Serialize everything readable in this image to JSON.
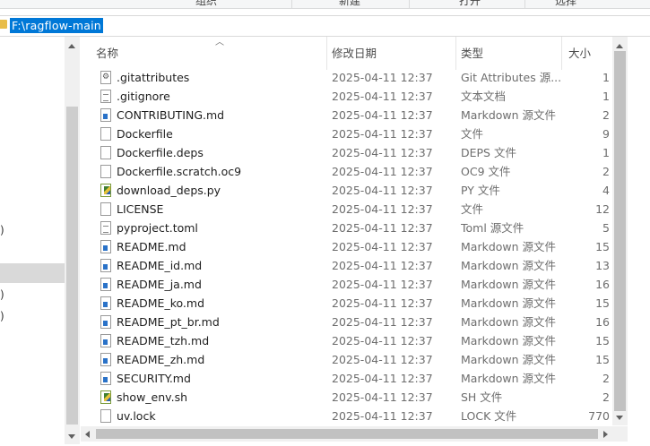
{
  "ribbon": {
    "groups": [
      {
        "label": "组织"
      },
      {
        "label": "新建"
      },
      {
        "label": "打开"
      },
      {
        "label": "选择"
      }
    ]
  },
  "address": {
    "path": "F:\\ragflow-main"
  },
  "nav": {
    "items": [
      {
        "label": ":)"
      },
      {
        "label": ")"
      },
      {
        "label": ":)"
      },
      {
        "label": ":)"
      }
    ],
    "selected_index": 1
  },
  "list": {
    "columns": {
      "name": "名称",
      "date": "修改日期",
      "type": "类型",
      "size": "大小"
    },
    "sort_column": "name",
    "files": [
      {
        "name": ".gitattributes",
        "date": "2025-04-11 12:37",
        "type": "Git Attributes 源...",
        "size": "1",
        "icon": "gear-file-icon"
      },
      {
        "name": ".gitignore",
        "date": "2025-04-11 12:37",
        "type": "文本文档",
        "size": "1",
        "icon": "text-file-icon"
      },
      {
        "name": "CONTRIBUTING.md",
        "date": "2025-04-11 12:37",
        "type": "Markdown 源文件",
        "size": "2",
        "icon": "markdown-file-icon"
      },
      {
        "name": "Dockerfile",
        "date": "2025-04-11 12:37",
        "type": "文件",
        "size": "9",
        "icon": "blank-file-icon"
      },
      {
        "name": "Dockerfile.deps",
        "date": "2025-04-11 12:37",
        "type": "DEPS 文件",
        "size": "1",
        "icon": "blank-file-icon"
      },
      {
        "name": "Dockerfile.scratch.oc9",
        "date": "2025-04-11 12:37",
        "type": "OC9 文件",
        "size": "2",
        "icon": "blank-file-icon"
      },
      {
        "name": "download_deps.py",
        "date": "2025-04-11 12:37",
        "type": "PY 文件",
        "size": "4",
        "icon": "python-file-icon"
      },
      {
        "name": "LICENSE",
        "date": "2025-04-11 12:37",
        "type": "文件",
        "size": "12",
        "icon": "blank-file-icon"
      },
      {
        "name": "pyproject.toml",
        "date": "2025-04-11 12:37",
        "type": "Toml 源文件",
        "size": "5",
        "icon": "text-file-icon"
      },
      {
        "name": "README.md",
        "date": "2025-04-11 12:37",
        "type": "Markdown 源文件",
        "size": "15",
        "icon": "markdown-file-icon"
      },
      {
        "name": "README_id.md",
        "date": "2025-04-11 12:37",
        "type": "Markdown 源文件",
        "size": "13",
        "icon": "markdown-file-icon"
      },
      {
        "name": "README_ja.md",
        "date": "2025-04-11 12:37",
        "type": "Markdown 源文件",
        "size": "16",
        "icon": "markdown-file-icon"
      },
      {
        "name": "README_ko.md",
        "date": "2025-04-11 12:37",
        "type": "Markdown 源文件",
        "size": "15",
        "icon": "markdown-file-icon"
      },
      {
        "name": "README_pt_br.md",
        "date": "2025-04-11 12:37",
        "type": "Markdown 源文件",
        "size": "16",
        "icon": "markdown-file-icon"
      },
      {
        "name": "README_tzh.md",
        "date": "2025-04-11 12:37",
        "type": "Markdown 源文件",
        "size": "15",
        "icon": "markdown-file-icon"
      },
      {
        "name": "README_zh.md",
        "date": "2025-04-11 12:37",
        "type": "Markdown 源文件",
        "size": "15",
        "icon": "markdown-file-icon"
      },
      {
        "name": "SECURITY.md",
        "date": "2025-04-11 12:37",
        "type": "Markdown 源文件",
        "size": "2",
        "icon": "markdown-file-icon"
      },
      {
        "name": "show_env.sh",
        "date": "2025-04-11 12:37",
        "type": "SH 文件",
        "size": "2",
        "icon": "script-file-icon"
      },
      {
        "name": "uv.lock",
        "date": "2025-04-11 12:37",
        "type": "LOCK 文件",
        "size": "770",
        "icon": "blank-file-icon"
      }
    ]
  },
  "colors": {
    "selection": "#0078d7",
    "nav_selected": "#d9d9d9",
    "scrollbar_thumb": "#c1c1c1"
  }
}
